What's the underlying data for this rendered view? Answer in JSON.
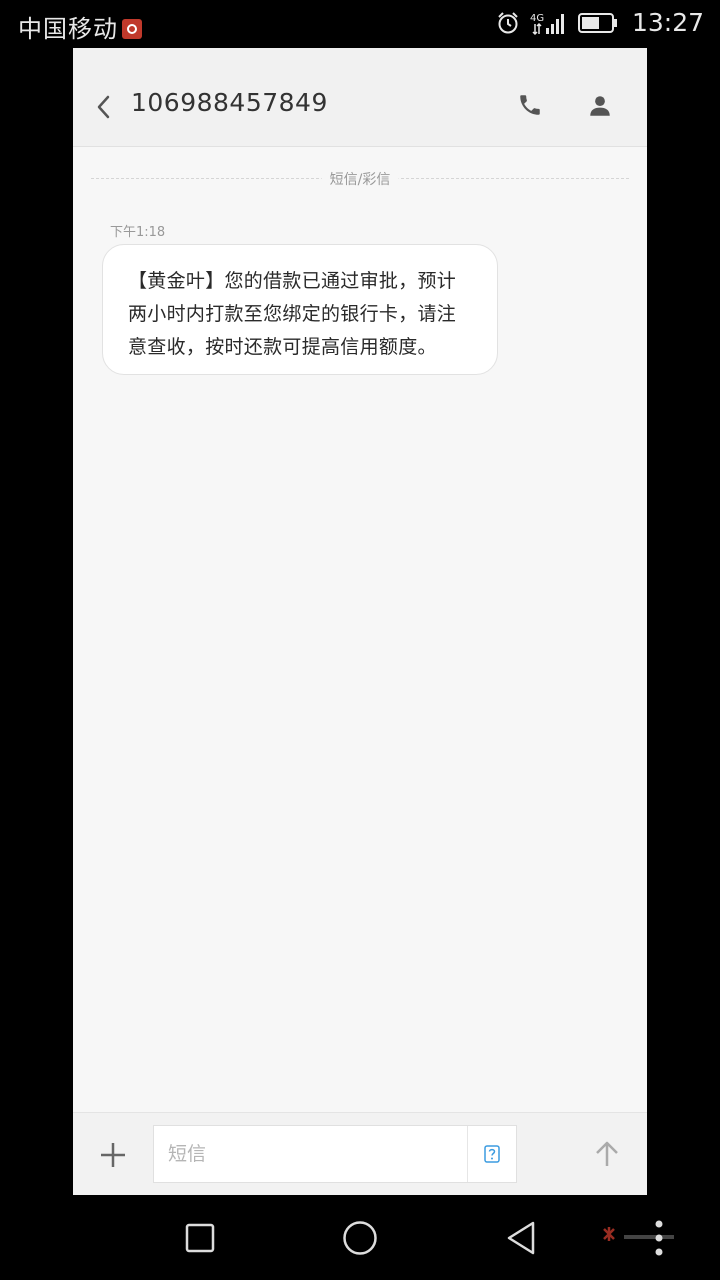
{
  "status_bar": {
    "carrier": "中国移动",
    "network": "4G",
    "time": "13:27"
  },
  "header": {
    "title": "106988457849"
  },
  "conversation": {
    "divider_label": "短信/彩信",
    "messages": [
      {
        "time": "下午1:18",
        "text": "【黄金叶】您的借款已通过审批，预计两小时内打款至您绑定的银行卡，请注意查收，按时还款可提高信用额度。"
      }
    ]
  },
  "composer": {
    "placeholder": "短信"
  },
  "icons": {
    "back": "chevron-left-icon",
    "call": "phone-icon",
    "contact": "person-icon",
    "add": "plus-icon",
    "template": "sms-template-icon",
    "send": "arrow-up-icon"
  },
  "colors": {
    "screen_bg": "#000000",
    "app_bg": "#f7f7f7",
    "header_bg": "#f1f1f1",
    "bubble_bg": "#ffffff",
    "accent": "#3b9be0"
  }
}
